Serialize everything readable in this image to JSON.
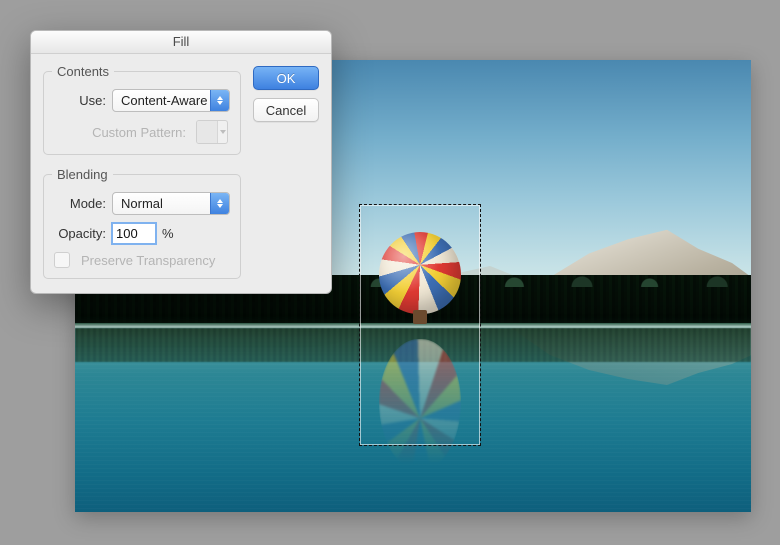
{
  "dialog": {
    "title": "Fill",
    "contents": {
      "legend": "Contents",
      "use_label": "Use:",
      "use_value": "Content-Aware",
      "custom_pattern_label": "Custom Pattern:"
    },
    "blending": {
      "legend": "Blending",
      "mode_label": "Mode:",
      "mode_value": "Normal",
      "opacity_label": "Opacity:",
      "opacity_value": "100",
      "opacity_unit": "%",
      "preserve_transparency_label": "Preserve Transparency"
    },
    "buttons": {
      "ok": "OK",
      "cancel": "Cancel"
    }
  }
}
